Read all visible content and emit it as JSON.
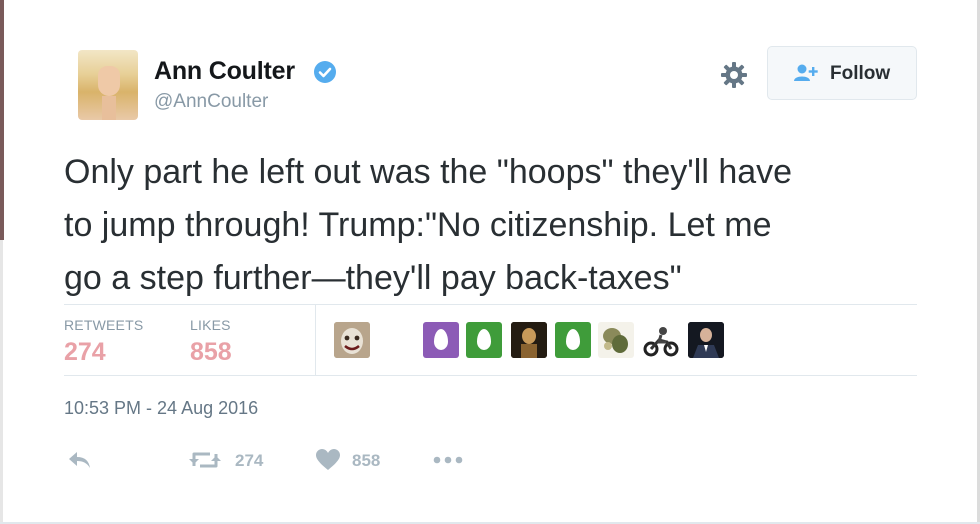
{
  "user": {
    "display_name": "Ann Coulter",
    "handle": "@AnnCoulter",
    "verified": true
  },
  "header": {
    "follow_label": "Follow"
  },
  "tweet": {
    "text": "Only part he left out was the \"hoops\" they'll have\nto jump through!  Trump:\"No citizenship. Let me\ngo a step further—they'll pay back-taxes\"",
    "timestamp": "10:53 PM - 24 Aug 2016"
  },
  "stats": {
    "retweets_label": "RETWEETS",
    "retweets_value": "274",
    "likes_label": "LIKES",
    "likes_value": "858"
  },
  "actions": {
    "retweet_count": "274",
    "like_count": "858"
  },
  "colors": {
    "stat_value": "#e9a1a7",
    "verified_badge": "#55acee",
    "muted_text": "#8899a6",
    "egg_purple": "#8c5bb6",
    "egg_green": "#3f9c3a"
  }
}
